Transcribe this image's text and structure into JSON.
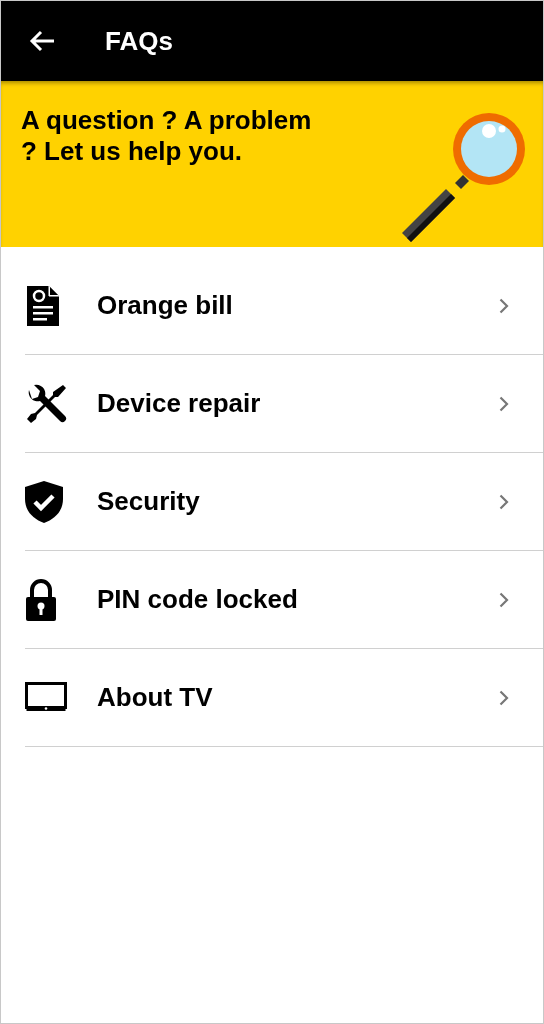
{
  "app_bar": {
    "title": "FAQs"
  },
  "banner": {
    "text": "A question ? A problem ? Let us help you."
  },
  "topics": [
    {
      "kind": "bill",
      "label": "Orange bill"
    },
    {
      "kind": "tools",
      "label": "Device repair"
    },
    {
      "kind": "shield",
      "label": "Security"
    },
    {
      "kind": "lock",
      "label": "PIN code locked"
    },
    {
      "kind": "tv",
      "label": "About TV"
    }
  ]
}
